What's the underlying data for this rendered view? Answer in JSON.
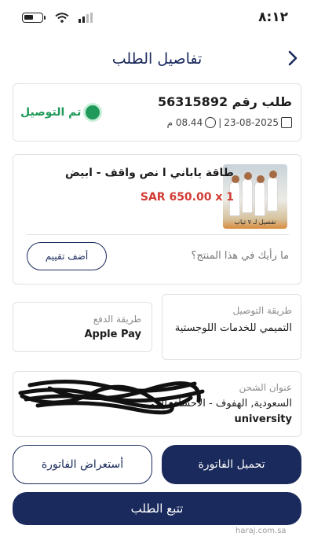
{
  "status_bar": {
    "time": "٨:١٢"
  },
  "header": {
    "title": "تفاصيل الطلب"
  },
  "order": {
    "number_label": "طلب رقم 56315892",
    "date": "23-08-2025",
    "separator": "|",
    "time": "08.44 م",
    "status": "تم التوصيل",
    "status_color": "#1f9a5a"
  },
  "product": {
    "name": "طاقة ياباني ا نص واقف - ابيض",
    "price": "SAR 650.00 x 1",
    "image_caption": "تفصيل لـ ٧ ثياب",
    "review_question": "ما رأيك في هذا المنتج؟",
    "rate_button": "أضف تقييم"
  },
  "delivery": {
    "label": "طريقة التوصيل",
    "value": "التميمي للخدمات اللوجستية"
  },
  "payment": {
    "label": "طريقة الدفع",
    "value": "Apple Pay"
  },
  "address": {
    "label": "عنوان الشحن",
    "line1": "السعودية, الهفوف - الاحساء، الحي",
    "line2": "university"
  },
  "buttons": {
    "download_invoice": "تحميل الفاتورة",
    "view_invoice": "أستعراض الفاتورة",
    "track_order": "تتبع الطلب"
  },
  "watermark": "haraj.com.sa",
  "colors": {
    "primary": "#1a2a5c",
    "price": "#d23b34"
  }
}
